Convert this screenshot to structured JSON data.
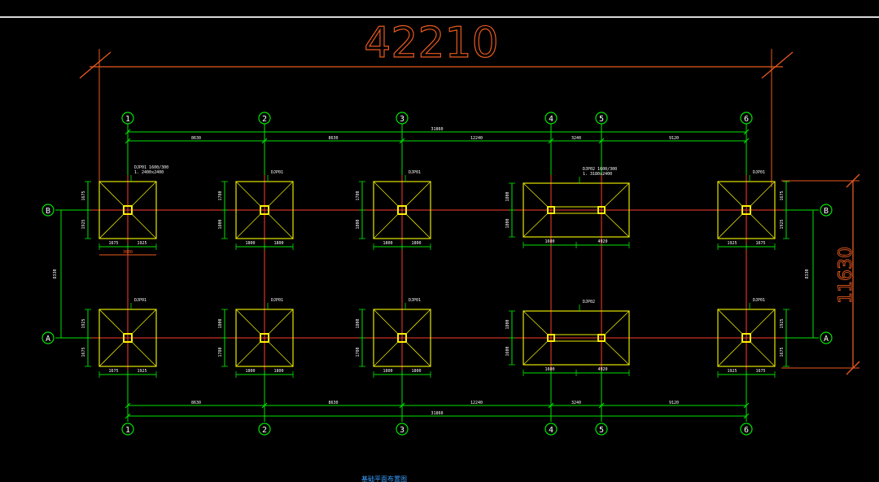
{
  "colors": {
    "background": "#000000",
    "grid_line": "#ff3b2f",
    "dimension": "#00e400",
    "footing": "#e6e600",
    "column": "#ffee00",
    "overall_dim": "#e85a1e",
    "label": "#ffffff",
    "caption": "#3aa0ff"
  },
  "overall": {
    "width_dim": "42210",
    "height_dim": "11630"
  },
  "grid": {
    "columns": [
      "1",
      "2",
      "3",
      "4",
      "5",
      "6"
    ],
    "rows": [
      "B",
      "A"
    ]
  },
  "spans": {
    "top": [
      "8630",
      "8630",
      "12240",
      "3240",
      "9120"
    ],
    "bottom": [
      "8630",
      "8630",
      "12240",
      "3240",
      "9120"
    ],
    "total": "31860",
    "row_spacing_left": "8330",
    "row_spacing_right": "8330"
  },
  "footing_labels": {
    "b1": "DJP01 1600/300\n1. 2400x2400",
    "b2": "DJP01",
    "b3": "DJP01",
    "b45": "DJP02 1600/300\n1. 3180x2400",
    "b6": "DJP01",
    "a1": "DJP01",
    "a2": "DJP01",
    "a3": "DJP01",
    "a45": "DJP02",
    "a6": "DJP01"
  },
  "footing_dims": {
    "b1": {
      "w1": "1675",
      "w2": "1925",
      "h1": "1675",
      "h2": "1925",
      "extra": "3600"
    },
    "b2": {
      "w1": "1800",
      "w2": "1800",
      "h1": "1780",
      "h2": "1800"
    },
    "b3": {
      "w1": "1800",
      "w2": "1800",
      "h1": "1780",
      "h2": "1800"
    },
    "b45": {
      "w1": "1600",
      "w2": "4920",
      "h1": "1800",
      "h2": "1800"
    },
    "b6": {
      "w1": "1925",
      "w2": "1675",
      "h1": "1675",
      "h2": "1925"
    },
    "a1": {
      "w1": "1675",
      "w2": "1925",
      "h1": "1925",
      "h2": "1675"
    },
    "a2": {
      "w1": "1800",
      "w2": "1800",
      "h1": "1800",
      "h2": "1780"
    },
    "a3": {
      "w1": "1800",
      "w2": "1800",
      "h1": "1800",
      "h2": "1780"
    },
    "a45": {
      "w1": "1600",
      "w2": "4920",
      "h1": "1800",
      "h2": "1600"
    },
    "a6": {
      "w1": "1925",
      "w2": "1675",
      "h1": "1925",
      "h2": "1675"
    }
  },
  "caption": "基础平面布置图"
}
